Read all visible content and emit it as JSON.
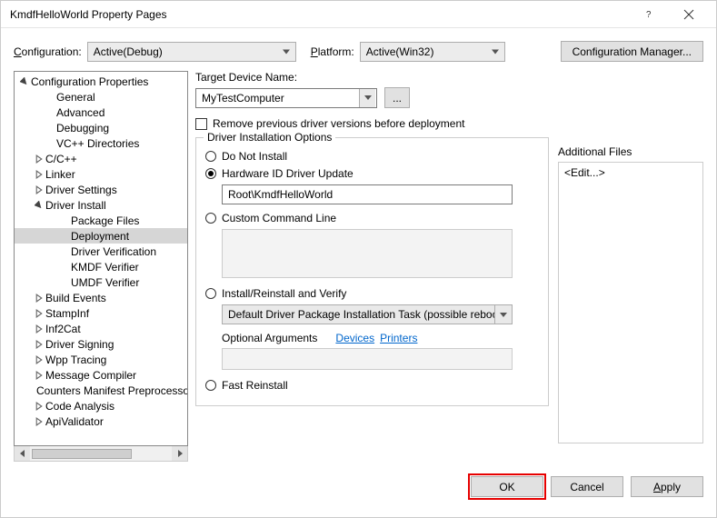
{
  "window": {
    "title": "KmdfHelloWorld Property Pages"
  },
  "topbar": {
    "configuration_label": "Configuration:",
    "configuration_value": "Active(Debug)",
    "platform_label": "Platform:",
    "platform_value": "Active(Win32)",
    "config_manager": "Configuration Manager..."
  },
  "tree": [
    {
      "label": "Configuration Properties",
      "indent": 0,
      "exp": "open"
    },
    {
      "label": "General",
      "indent": 1,
      "exp": "none"
    },
    {
      "label": "Advanced",
      "indent": 1,
      "exp": "none"
    },
    {
      "label": "Debugging",
      "indent": 1,
      "exp": "none"
    },
    {
      "label": "VC++ Directories",
      "indent": 1,
      "exp": "none"
    },
    {
      "label": "C/C++",
      "indent": 1,
      "exp": "closed"
    },
    {
      "label": "Linker",
      "indent": 1,
      "exp": "closed"
    },
    {
      "label": "Driver Settings",
      "indent": 1,
      "exp": "closed"
    },
    {
      "label": "Driver Install",
      "indent": 1,
      "exp": "open"
    },
    {
      "label": "Package Files",
      "indent": 2,
      "exp": "none"
    },
    {
      "label": "Deployment",
      "indent": 2,
      "exp": "none",
      "selected": true
    },
    {
      "label": "Driver Verification",
      "indent": 2,
      "exp": "none"
    },
    {
      "label": "KMDF Verifier",
      "indent": 2,
      "exp": "none"
    },
    {
      "label": "UMDF Verifier",
      "indent": 2,
      "exp": "none"
    },
    {
      "label": "Build Events",
      "indent": 1,
      "exp": "closed"
    },
    {
      "label": "StampInf",
      "indent": 1,
      "exp": "closed"
    },
    {
      "label": "Inf2Cat",
      "indent": 1,
      "exp": "closed"
    },
    {
      "label": "Driver Signing",
      "indent": 1,
      "exp": "closed"
    },
    {
      "label": "Wpp Tracing",
      "indent": 1,
      "exp": "closed"
    },
    {
      "label": "Message Compiler",
      "indent": 1,
      "exp": "closed"
    },
    {
      "label": "Counters Manifest Preprocessor",
      "indent": 1,
      "exp": "closed"
    },
    {
      "label": "Code Analysis",
      "indent": 1,
      "exp": "closed"
    },
    {
      "label": "ApiValidator",
      "indent": 1,
      "exp": "closed"
    }
  ],
  "panel": {
    "target_device_label": "Target Device Name:",
    "target_device_value": "MyTestComputer",
    "browse_label": "...",
    "remove_prev_label": "Remove previous driver versions before deployment",
    "group_title": "Driver Installation Options",
    "opt_do_not_install": "Do Not Install",
    "opt_hwid_update": "Hardware ID Driver Update",
    "hwid_value": "Root\\KmdfHelloWorld",
    "opt_custom_cmd": "Custom Command Line",
    "opt_install_verify": "Install/Reinstall and Verify",
    "install_task_value": "Default Driver Package Installation Task (possible reboot)",
    "optional_args_label": "Optional Arguments",
    "link_devices": "Devices",
    "link_printers": "Printers",
    "opt_fast_reinstall": "Fast Reinstall",
    "additional_files_label": "Additional Files",
    "additional_files_value": "<Edit...>"
  },
  "footer": {
    "ok": "OK",
    "cancel": "Cancel",
    "apply": "Apply"
  }
}
